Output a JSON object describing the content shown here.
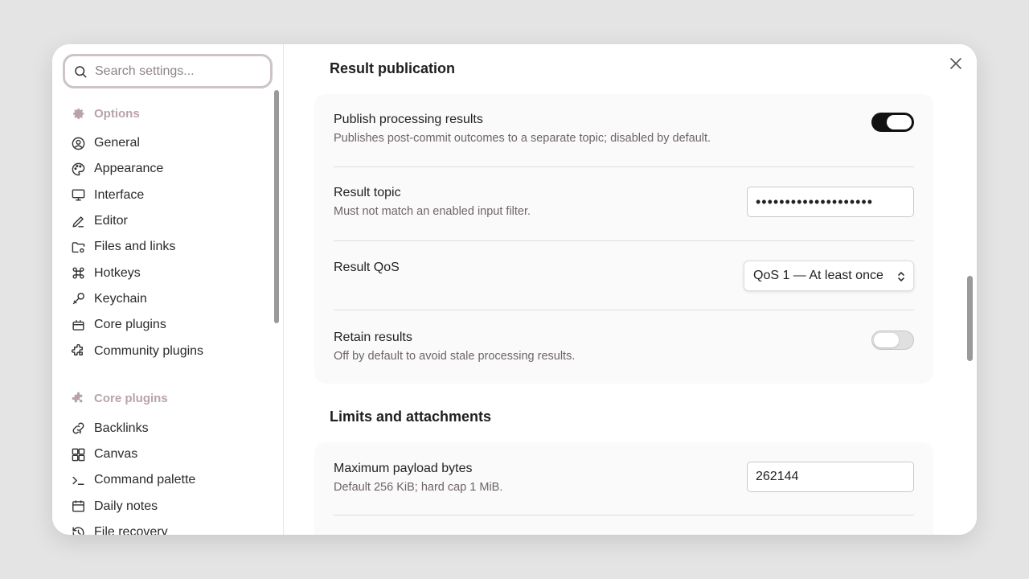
{
  "search": {
    "placeholder": "Search settings..."
  },
  "sidebar": {
    "options_label": "Options",
    "options_items": [
      {
        "label": "General",
        "icon": "user-circle-icon"
      },
      {
        "label": "Appearance",
        "icon": "palette-icon"
      },
      {
        "label": "Interface",
        "icon": "monitor-icon"
      },
      {
        "label": "Editor",
        "icon": "pencil-icon"
      },
      {
        "label": "Files and links",
        "icon": "folder-gear-icon"
      },
      {
        "label": "Hotkeys",
        "icon": "command-icon"
      },
      {
        "label": "Keychain",
        "icon": "key-icon"
      },
      {
        "label": "Core plugins",
        "icon": "plug-box-icon"
      },
      {
        "label": "Community plugins",
        "icon": "puzzle-icon"
      }
    ],
    "core_label": "Core plugins",
    "core_items": [
      {
        "label": "Backlinks",
        "icon": "backlink-icon"
      },
      {
        "label": "Canvas",
        "icon": "canvas-icon"
      },
      {
        "label": "Command palette",
        "icon": "terminal-icon"
      },
      {
        "label": "Daily notes",
        "icon": "calendar-icon"
      },
      {
        "label": "File recovery",
        "icon": "history-icon"
      }
    ]
  },
  "main": {
    "section1_title": "Result publication",
    "publish": {
      "name": "Publish processing results",
      "desc": "Publishes post-commit outcomes to a separate topic; disabled by default.",
      "enabled": true
    },
    "topic": {
      "name": "Result topic",
      "desc": "Must not match an enabled input filter.",
      "value": "••••••••••••••••••••"
    },
    "qos": {
      "name": "Result QoS",
      "selected": "QoS 1 — At least once"
    },
    "retain": {
      "name": "Retain results",
      "desc": "Off by default to avoid stale processing results.",
      "enabled": false
    },
    "section2_title": "Limits and attachments",
    "max_payload": {
      "name": "Maximum payload bytes",
      "desc": "Default 256 KiB; hard cap 1 MiB.",
      "value": "262144"
    }
  }
}
